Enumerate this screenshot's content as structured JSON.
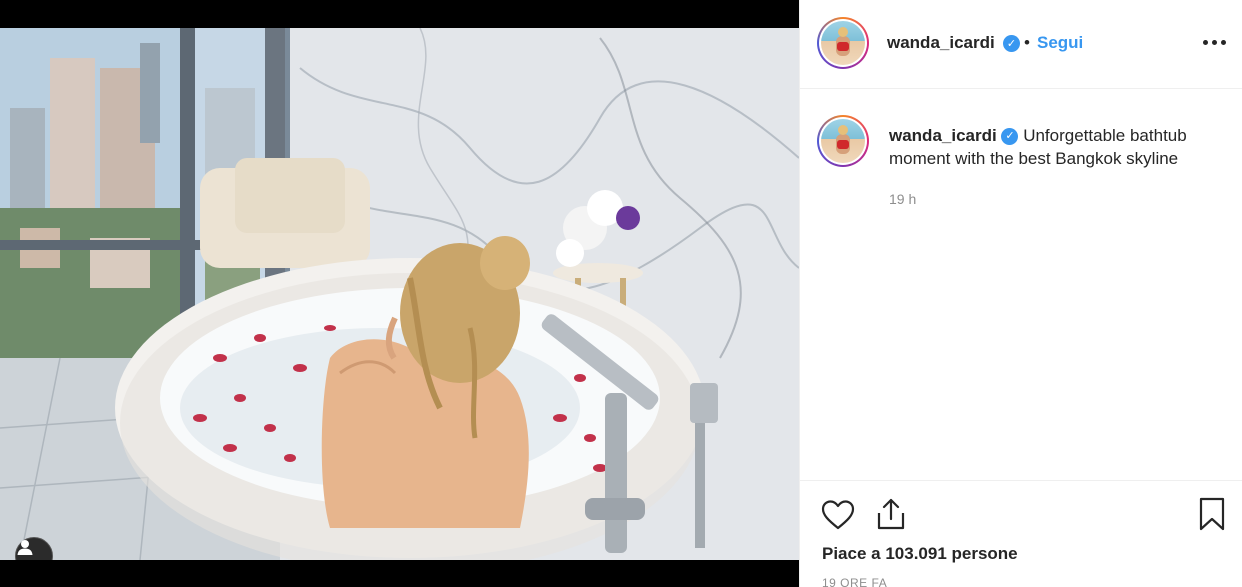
{
  "post": {
    "media_alt_description_hidden": "",
    "user_tag_icon": "user-tag-icon"
  },
  "header": {
    "username": "wanda_icardi",
    "verified_icon": "verified-badge-icon",
    "separator": "•",
    "follow_label": "Segui",
    "more_icon": "more-options-icon"
  },
  "caption": {
    "username": "wanda_icardi",
    "text": "Unforgettable bathtub moment with the best Bangkok skyline",
    "time": "19 h"
  },
  "actions": {
    "like_icon": "heart-icon",
    "share_icon": "share-icon",
    "save_icon": "bookmark-icon"
  },
  "stats": {
    "likes_text": "Piace a 103.091 persone",
    "timestamp": "19 ORE FA"
  },
  "colors": {
    "link": "#3897f0",
    "text": "#262626",
    "muted": "#8e8e8e",
    "border": "#efefef"
  }
}
